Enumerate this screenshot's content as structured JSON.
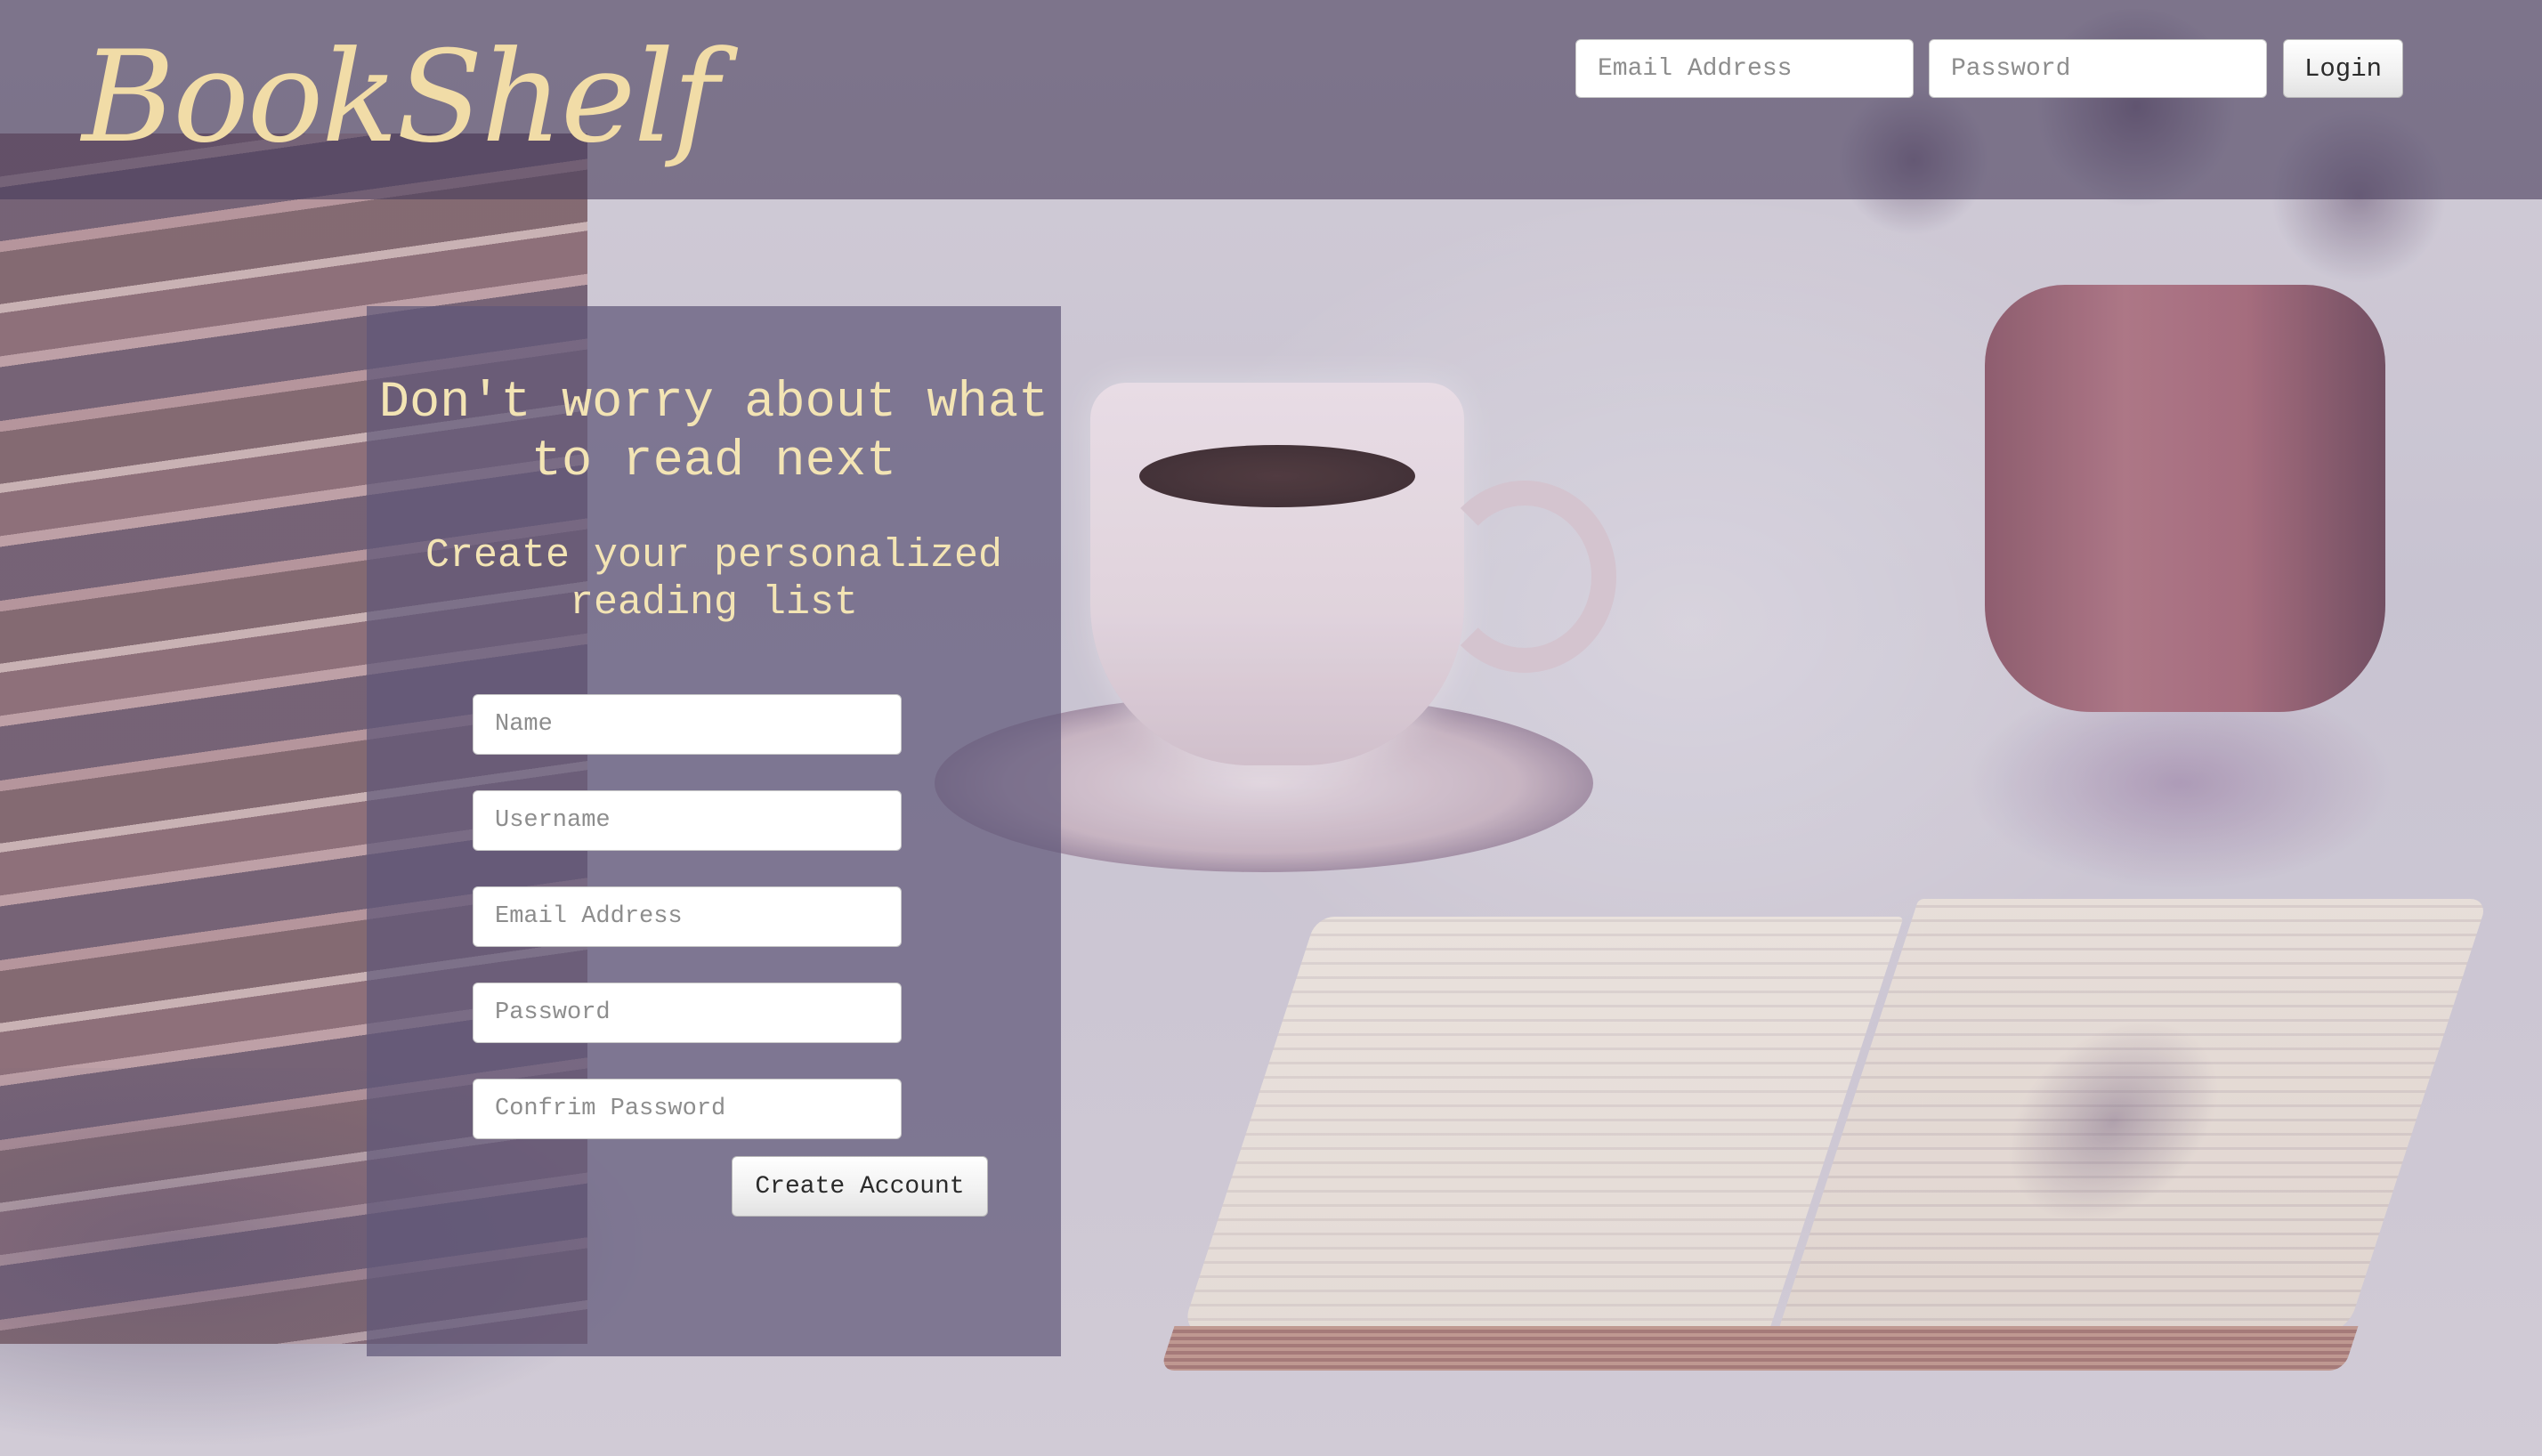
{
  "header": {
    "logo": "BookShelf",
    "login_form": {
      "email_placeholder": "Email Address",
      "password_placeholder": "Password",
      "login_label": "Login"
    }
  },
  "signup": {
    "heading": "Don't worry about what to read next",
    "subheading": "Create your personalized reading list",
    "fields": {
      "name_placeholder": "Name",
      "username_placeholder": "Username",
      "email_placeholder": "Email Address",
      "password_placeholder": "Password",
      "confirm_placeholder": "Confrim Password"
    },
    "submit_label": "Create Account"
  },
  "colors": {
    "header_overlay": "#483e5c",
    "panel_overlay": "#605878",
    "accent_text": "#f3e4b4",
    "logo_color": "#f1dca7"
  },
  "icons": {
    "background": "photo of books, coffee cup, vase and open book"
  }
}
